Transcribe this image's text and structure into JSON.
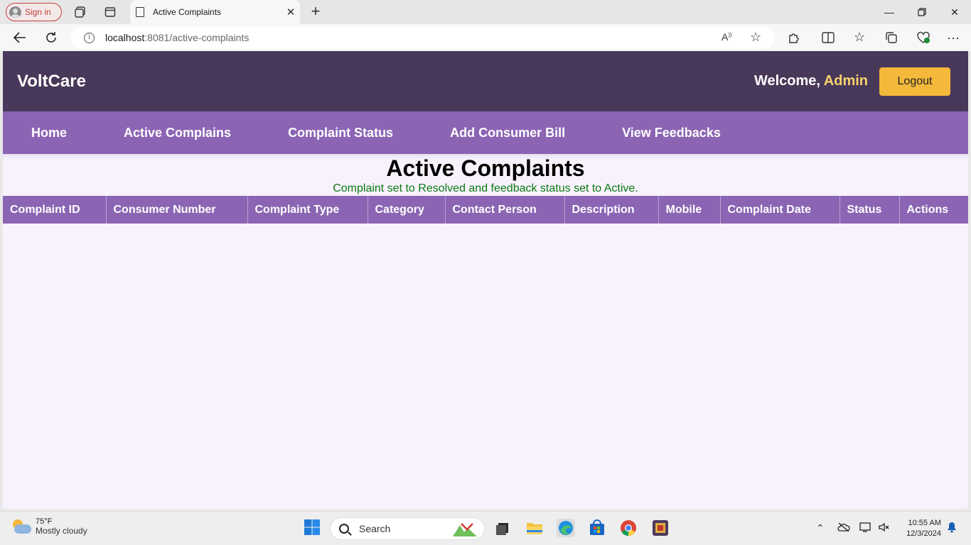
{
  "browser": {
    "signin_label": "Sign in",
    "tab_title": "Active Complaints",
    "url_host": "localhost",
    "url_rest": ":8081/active-complaints"
  },
  "app": {
    "brand": "VoltCare",
    "welcome_prefix": "Welcome,",
    "user_name": "Admin",
    "logout_label": "Logout",
    "nav": [
      {
        "label": "Home"
      },
      {
        "label": "Active Complains"
      },
      {
        "label": "Complaint Status"
      },
      {
        "label": "Add Consumer Bill"
      },
      {
        "label": "View Feedbacks"
      }
    ],
    "page_title": "Active Complaints",
    "message": "Complaint set to Resolved and feedback status set to Active.",
    "table": {
      "columns": [
        "Complaint ID",
        "Consumer Number",
        "Complaint Type",
        "Category",
        "Contact Person",
        "Description",
        "Mobile",
        "Complaint Date",
        "Status",
        "Actions"
      ],
      "rows": []
    },
    "colors": {
      "header_bg": "#483859",
      "nav_bg": "#8b65b3",
      "logout_bg": "#f4b83a",
      "admin_accent": "#f9d26d",
      "message_green": "#0a7a12",
      "page_bg": "#f8f2fd"
    }
  },
  "taskbar": {
    "weather_temp": "75°F",
    "weather_desc": "Mostly cloudy",
    "search_label": "Search",
    "time": "10:55 AM",
    "date": "12/3/2024"
  }
}
